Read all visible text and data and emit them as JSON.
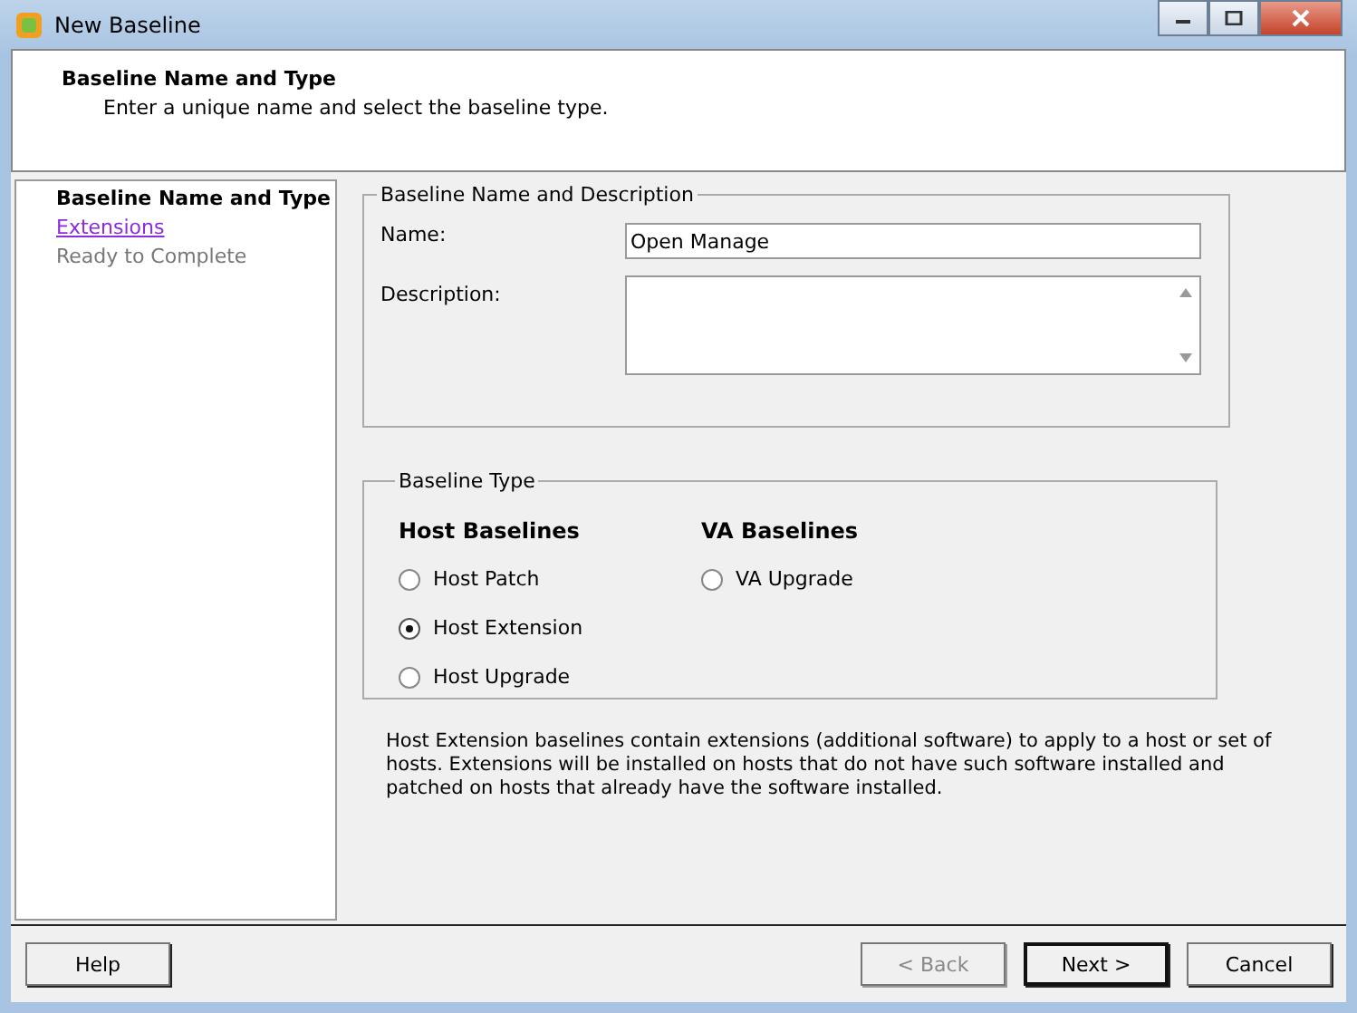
{
  "window": {
    "title": "New Baseline"
  },
  "header": {
    "title": "Baseline Name and Type",
    "subtitle": "Enter a unique name and select the baseline type."
  },
  "steps": [
    {
      "label": "Baseline Name and Type",
      "kind": "current"
    },
    {
      "label": "Extensions",
      "kind": "link"
    },
    {
      "label": "Ready to Complete",
      "kind": "pending"
    }
  ],
  "name_group": {
    "legend": "Baseline Name and Description",
    "name_label": "Name:",
    "name_value": "Open Manage",
    "description_label": "Description:"
  },
  "type_group": {
    "legend": "Baseline Type",
    "columns": [
      {
        "heading": "Host Baselines",
        "options": [
          {
            "label": "Host Patch",
            "selected": false
          },
          {
            "label": "Host Extension",
            "selected": true
          },
          {
            "label": "Host Upgrade",
            "selected": false
          }
        ]
      },
      {
        "heading": "VA Baselines",
        "options": [
          {
            "label": "VA Upgrade",
            "selected": false
          }
        ]
      }
    ]
  },
  "help_text": "Host Extension baselines contain extensions (additional software) to apply to a host or set of hosts. Extensions will be installed on hosts that do not have such software installed and patched on hosts that already have the software installed.",
  "buttons": [
    {
      "label": "Help",
      "disabled": false,
      "default": false
    },
    {
      "label": "< Back",
      "disabled": true,
      "default": false
    },
    {
      "label": "Next >",
      "disabled": false,
      "default": true
    },
    {
      "label": "Cancel",
      "disabled": false,
      "default": false
    }
  ]
}
